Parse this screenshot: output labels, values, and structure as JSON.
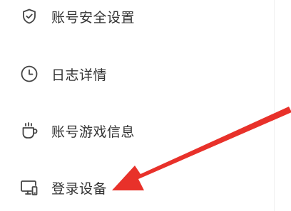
{
  "menu": {
    "items": [
      {
        "label": "账号安全设置",
        "icon": "shield-check-icon"
      },
      {
        "label": "日志详情",
        "icon": "clock-icon"
      },
      {
        "label": "账号游戏信息",
        "icon": "mug-icon"
      },
      {
        "label": "登录设备",
        "icon": "devices-icon"
      }
    ]
  },
  "annotation": {
    "arrow_color": "#e8312a",
    "points_to": "登录设备"
  },
  "colors": {
    "text": "#333333",
    "icon": "#444444",
    "background": "#ffffff"
  }
}
